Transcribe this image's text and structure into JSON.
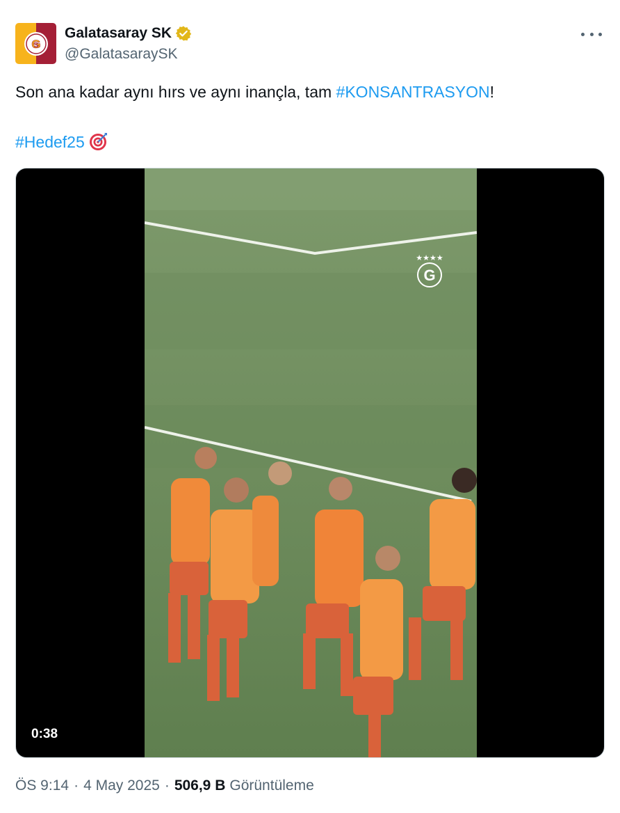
{
  "account": {
    "display_name": "Galatasaray SK",
    "handle": "@GalatasaraySK",
    "verified": true,
    "avatar_colors": [
      "#f7b31c",
      "#a41f36"
    ]
  },
  "tweet": {
    "text_before": "Son ana kadar aynı hırs ve aynı inançla, tam ",
    "hashtag_1": "#KONSANTRASYON",
    "text_after": "!",
    "hashtag_2": "#Hedef25",
    "emoji": "target-emoji"
  },
  "media": {
    "type": "video",
    "duration": "0:38"
  },
  "meta": {
    "time": "ÖS 9:14",
    "date": "4 May 2025",
    "separator": "·",
    "views_count": "506,9 B",
    "views_label": "Görüntüleme"
  },
  "colors": {
    "link": "#1d9bf0",
    "secondary_text": "#536471",
    "verified_badge": "#e2b719"
  }
}
